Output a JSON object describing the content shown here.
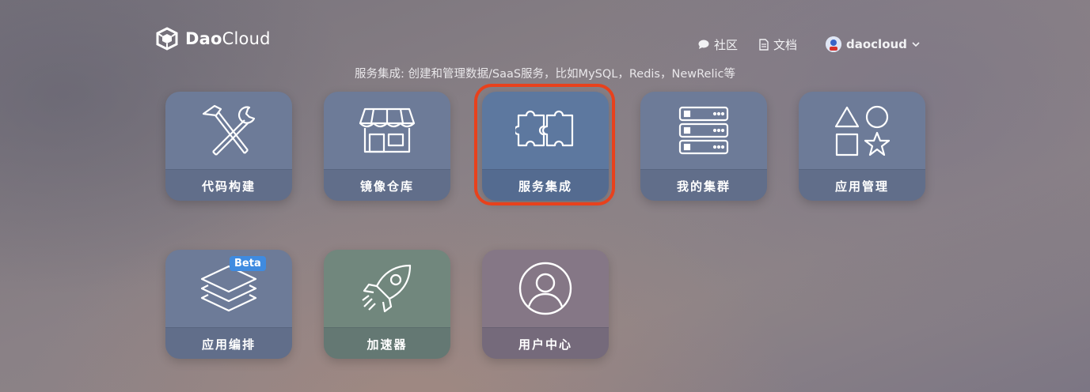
{
  "header": {
    "logo_text_bold": "Dao",
    "logo_text_light": "Cloud",
    "nav": {
      "community": "社区",
      "docs": "文档",
      "user": "daocloud"
    }
  },
  "subtitle": "服务集成: 创建和管理数据/SaaS服务，比如MySQL，Redis，NewRelic等",
  "tiles": [
    {
      "label": "代码构建",
      "icon": "tools-icon"
    },
    {
      "label": "镜像仓库",
      "icon": "store-icon"
    },
    {
      "label": "服务集成",
      "icon": "puzzle-icon"
    },
    {
      "label": "我的集群",
      "icon": "server-icon"
    },
    {
      "label": "应用管理",
      "icon": "shapes-icon"
    },
    {
      "label": "应用编排",
      "icon": "layers-icon",
      "badge": "Beta"
    },
    {
      "label": "加速器",
      "icon": "rocket-icon"
    },
    {
      "label": "用户中心",
      "icon": "user-icon"
    }
  ],
  "colors": {
    "highlight": "#e8411c",
    "badge": "#3f8be0"
  }
}
